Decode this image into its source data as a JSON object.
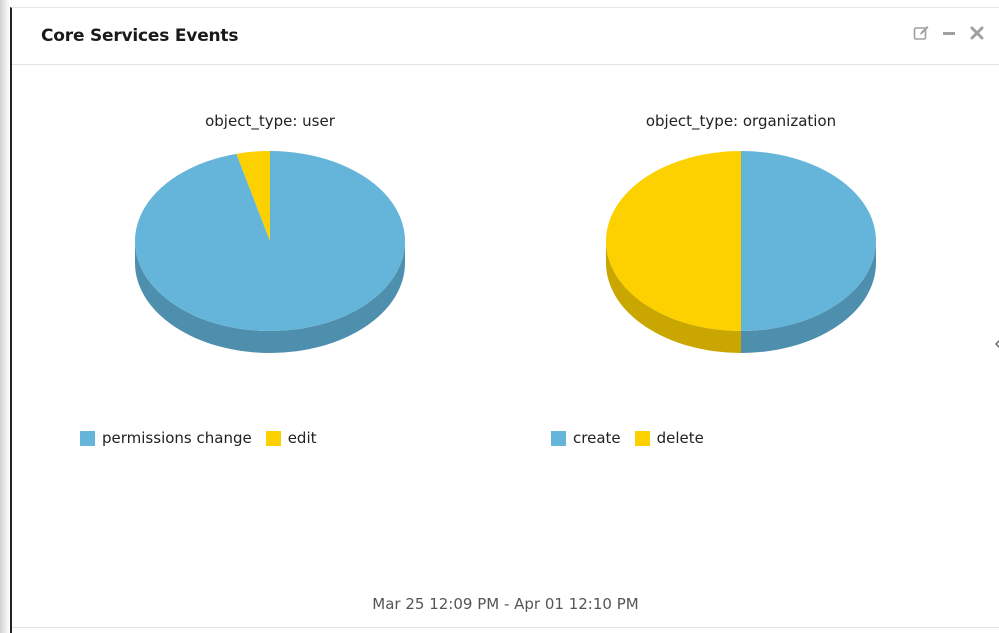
{
  "panel": {
    "title": "Core Services Events"
  },
  "header_tools": [
    {
      "icon": "edit-icon",
      "color": "#a0a0a0"
    },
    {
      "icon": "minimize-icon",
      "color": "#a0a0a0"
    },
    {
      "icon": "close-icon",
      "color": "#a0a0a0"
    }
  ],
  "colors": {
    "blue": "#65b5da",
    "blue_dark": "#4f8fae",
    "yellow": "#fdd000",
    "yellow_dark": "#caa600"
  },
  "chart_data": [
    {
      "type": "pie",
      "title": "object_type: user",
      "categories": [
        "permissions change",
        "edit"
      ],
      "values": [
        96,
        4
      ],
      "colors": [
        "#65b5da",
        "#fdd000"
      ],
      "legend_position": "bottom-left"
    },
    {
      "type": "pie",
      "title": "object_type: organization",
      "categories": [
        "create",
        "delete"
      ],
      "values": [
        50,
        50
      ],
      "colors": [
        "#65b5da",
        "#fdd000"
      ],
      "legend_position": "bottom-left"
    }
  ],
  "footer": {
    "time_range": "Mar 25 12:09 PM - Apr 01 12:10 PM"
  }
}
